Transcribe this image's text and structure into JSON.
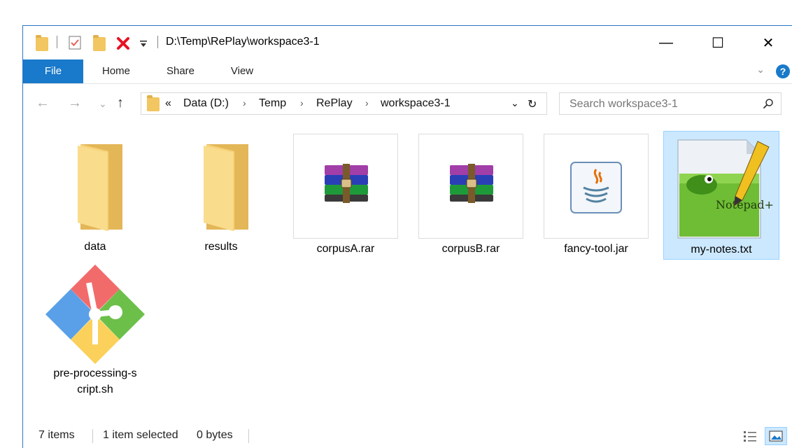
{
  "window": {
    "path_title": "D:\\Temp\\RePlay\\workspace3-1"
  },
  "window_controls": {
    "minimize": "—",
    "maximize": "☐",
    "close": "✕"
  },
  "ribbon": {
    "tabs": [
      "File",
      "Home",
      "Share",
      "View"
    ],
    "help": "?",
    "expand": "⌄"
  },
  "nav": {
    "back": "←",
    "forward": "→",
    "recent": "⌄",
    "up": "↑",
    "breadcrumb_overflow": "«",
    "breadcrumbs": [
      "Data (D:)",
      "Temp",
      "RePlay",
      "workspace3-1"
    ],
    "crumb_separator": "›",
    "dropdown": "⌄",
    "refresh": "↻"
  },
  "search": {
    "placeholder": "Search workspace3-1"
  },
  "items": [
    {
      "name": "data",
      "type": "folder"
    },
    {
      "name": "results",
      "type": "folder"
    },
    {
      "name": "corpusA.rar",
      "type": "rar-archive"
    },
    {
      "name": "corpusB.rar",
      "type": "rar-archive"
    },
    {
      "name": "fancy-tool.jar",
      "type": "java-archive"
    },
    {
      "name": "my-notes.txt",
      "type": "notepad-plus-plus-text",
      "selected": true
    },
    {
      "name_line1": "pre-processing-s",
      "name_line2": "cript.sh",
      "type": "git-script"
    }
  ],
  "status": {
    "item_count": "7 items",
    "selected": "1 item selected",
    "size": "0 bytes"
  },
  "icons": {
    "quick_access": [
      "folder-icon",
      "properties-icon",
      "new-folder-icon",
      "delete-icon",
      "customize-icon"
    ],
    "colors": {
      "accent": "#1979ca",
      "folder": "#f2c660",
      "delete": "#e81123",
      "selection": "#cce8ff"
    }
  }
}
